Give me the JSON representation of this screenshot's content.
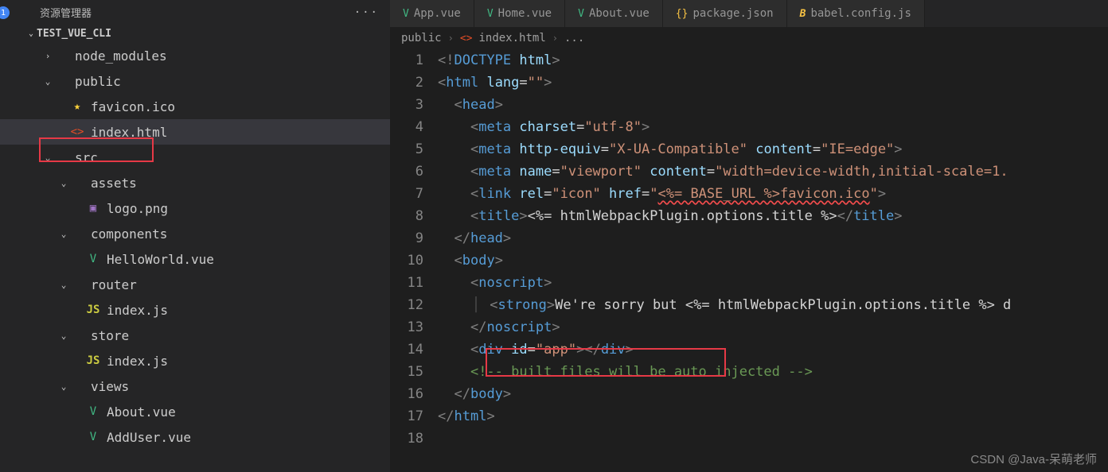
{
  "explorer": {
    "title": "资源管理器",
    "badge": "1",
    "projectName": "TEST_VUE_CLI",
    "tree": [
      {
        "indent": 52,
        "chev": ">",
        "icon": "",
        "cls": "",
        "label": "node_modules"
      },
      {
        "indent": 52,
        "chev": "v",
        "icon": "",
        "cls": "",
        "label": "public"
      },
      {
        "indent": 72,
        "chev": "",
        "icon": "★",
        "cls": "ic-star",
        "label": "favicon.ico"
      },
      {
        "indent": 72,
        "chev": "",
        "icon": "<>",
        "cls": "ic-html",
        "label": "index.html",
        "active": true
      },
      {
        "indent": 52,
        "chev": "v",
        "icon": "",
        "cls": "",
        "label": "src"
      },
      {
        "indent": 72,
        "chev": "v",
        "icon": "",
        "cls": "",
        "label": "assets"
      },
      {
        "indent": 92,
        "chev": "",
        "icon": "▣",
        "cls": "ic-img",
        "label": "logo.png"
      },
      {
        "indent": 72,
        "chev": "v",
        "icon": "",
        "cls": "",
        "label": "components"
      },
      {
        "indent": 92,
        "chev": "",
        "icon": "V",
        "cls": "ic-vue",
        "label": "HelloWorld.vue"
      },
      {
        "indent": 72,
        "chev": "v",
        "icon": "",
        "cls": "",
        "label": "router"
      },
      {
        "indent": 92,
        "chev": "",
        "icon": "JS",
        "cls": "ic-js",
        "label": "index.js"
      },
      {
        "indent": 72,
        "chev": "v",
        "icon": "",
        "cls": "",
        "label": "store"
      },
      {
        "indent": 92,
        "chev": "",
        "icon": "JS",
        "cls": "ic-js",
        "label": "index.js"
      },
      {
        "indent": 72,
        "chev": "v",
        "icon": "",
        "cls": "",
        "label": "views"
      },
      {
        "indent": 92,
        "chev": "",
        "icon": "V",
        "cls": "ic-vue",
        "label": "About.vue"
      },
      {
        "indent": 92,
        "chev": "",
        "icon": "V",
        "cls": "ic-vue",
        "label": "AddUser.vue"
      }
    ]
  },
  "tabs": [
    {
      "icon": "V",
      "cls": "ic-vue",
      "label": "App.vue"
    },
    {
      "icon": "V",
      "cls": "ic-vue",
      "label": "Home.vue"
    },
    {
      "icon": "V",
      "cls": "ic-vue",
      "label": "About.vue"
    },
    {
      "icon": "{}",
      "cls": "ic-json",
      "label": "package.json"
    },
    {
      "icon": "B",
      "cls": "ic-babel",
      "label": "babel.config.js"
    }
  ],
  "breadcrumbs": {
    "seg1": "public",
    "icon": "<>",
    "seg2": "index.html",
    "tail": "..."
  },
  "code": {
    "lines": 18,
    "l1": "<!DOCTYPE html>",
    "l2": "<html lang=\"\">",
    "l3": "  <head>",
    "l4": "    <meta charset=\"utf-8\">",
    "l5": "    <meta http-equiv=\"X-UA-Compatible\" content=\"IE=edge\">",
    "l6": "    <meta name=\"viewport\" content=\"width=device-width,initial-scale=1.",
    "l7": "    <link rel=\"icon\" href=\"<%= BASE_URL %>favicon.ico\">",
    "l8": "    <title><%= htmlWebpackPlugin.options.title %></title>",
    "l9": "  </head>",
    "l10": "  <body>",
    "l11": "    <noscript>",
    "l12": "      <strong>We're sorry but <%= htmlWebpackPlugin.options.title %> d",
    "l13": "    </noscript>",
    "l14": "    <div id=\"app\"></div>",
    "l15": "    <!-- built files will be auto injected -->",
    "l16": "  </body>",
    "l17": "</html>"
  },
  "watermark": "CSDN @Java-呆萌老师"
}
